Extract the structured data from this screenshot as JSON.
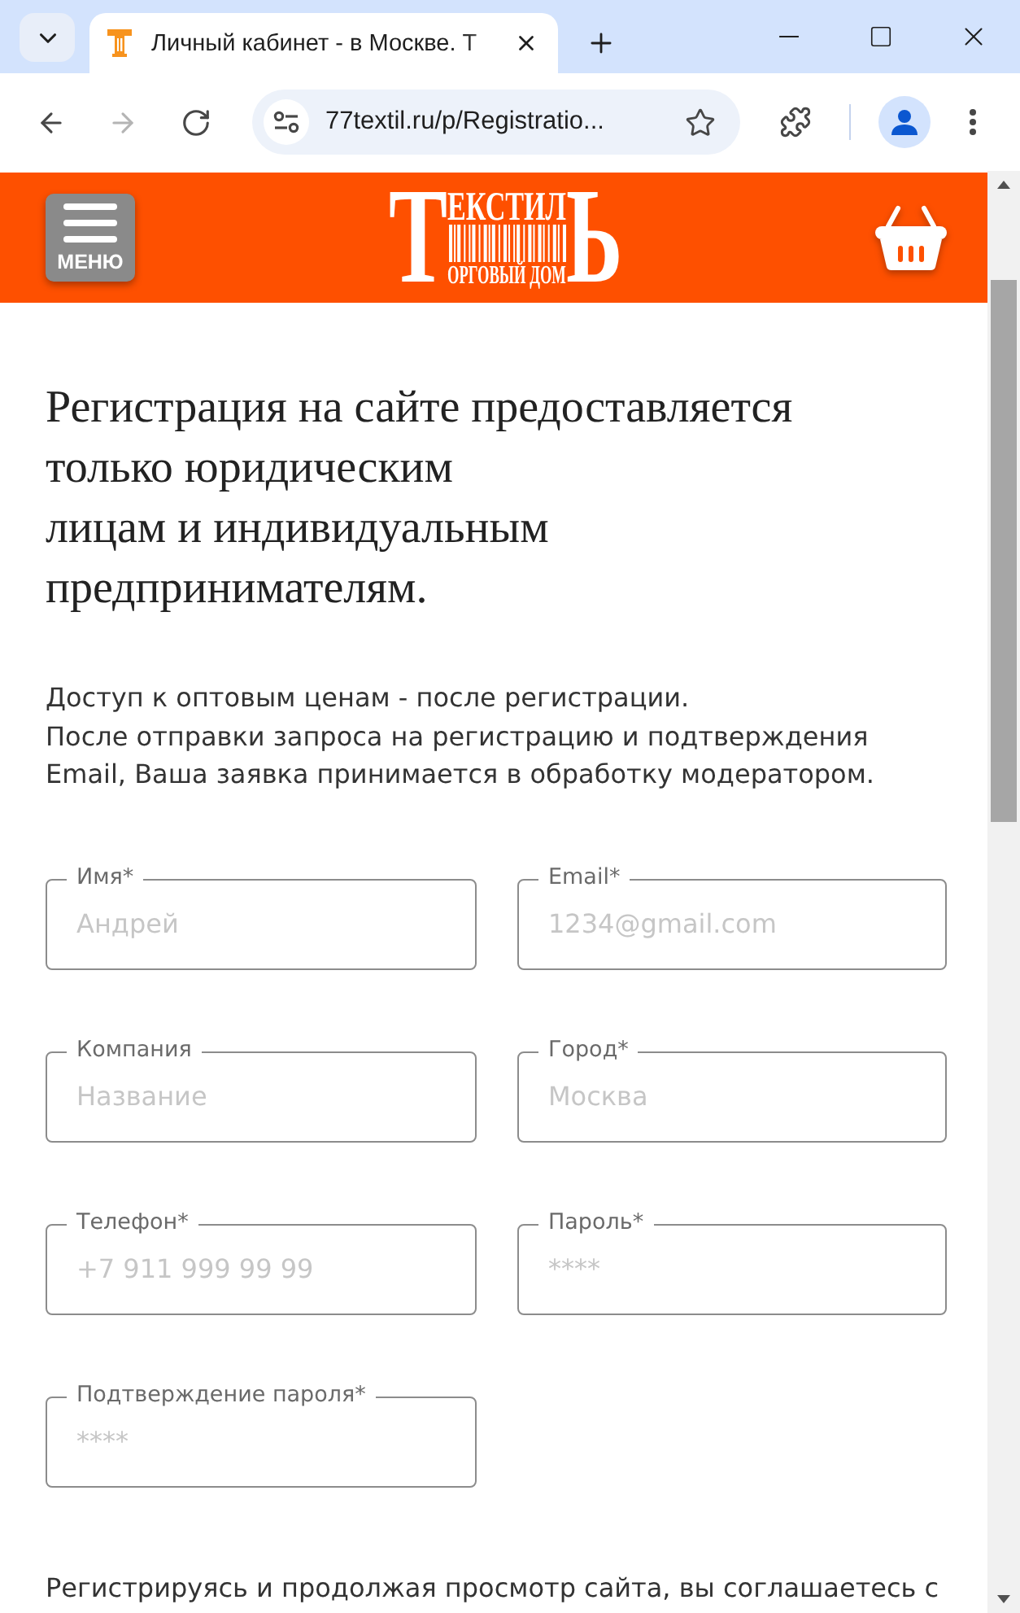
{
  "browser": {
    "tabs": [
      {
        "title": "Личный кабинет - в Москве. Т",
        "selected": true
      }
    ],
    "nav_buttons": [
      {
        "kind": "back",
        "disabled": false
      },
      {
        "kind": "forward",
        "disabled": true
      },
      {
        "kind": "reload",
        "disabled": false
      }
    ],
    "address": "77textil.ru/p/Registratio..."
  },
  "header": {
    "menu_label": "МЕНЮ",
    "logo": {
      "first_letter": "Т",
      "top_text": "ЕКСТИЛ",
      "bottom_text": "ОРГОВЫЙ ДОМ",
      "last_letter": "Ь"
    }
  },
  "heading": "Регистрация на сайте предоставляется\nтолько юридическим\nлицам и индивидуальным\nпредпринимателям.",
  "intro": "Доступ к оптовым ценам - после регистрации.\nПосле отправки запроса на регистрацию и подтверждения\nEmail, Ваша заявка принимается в обработку модератором.",
  "fields": [
    {
      "label": "Имя*",
      "placeholder": "Андрей"
    },
    {
      "label": "Email*",
      "placeholder": "1234@gmail.com"
    },
    {
      "label": "Компания",
      "placeholder": "Название"
    },
    {
      "label": "Город*",
      "placeholder": "Москва"
    },
    {
      "label": "Телефон*",
      "placeholder": "+7 911 999 99 99"
    },
    {
      "label": "Пароль*",
      "placeholder": "****"
    },
    {
      "label": "Подтверждение пароля*",
      "placeholder": "****"
    }
  ],
  "consent": "Регистрируясь и продолжая просмотр сайта, вы соглашаетесь с"
}
